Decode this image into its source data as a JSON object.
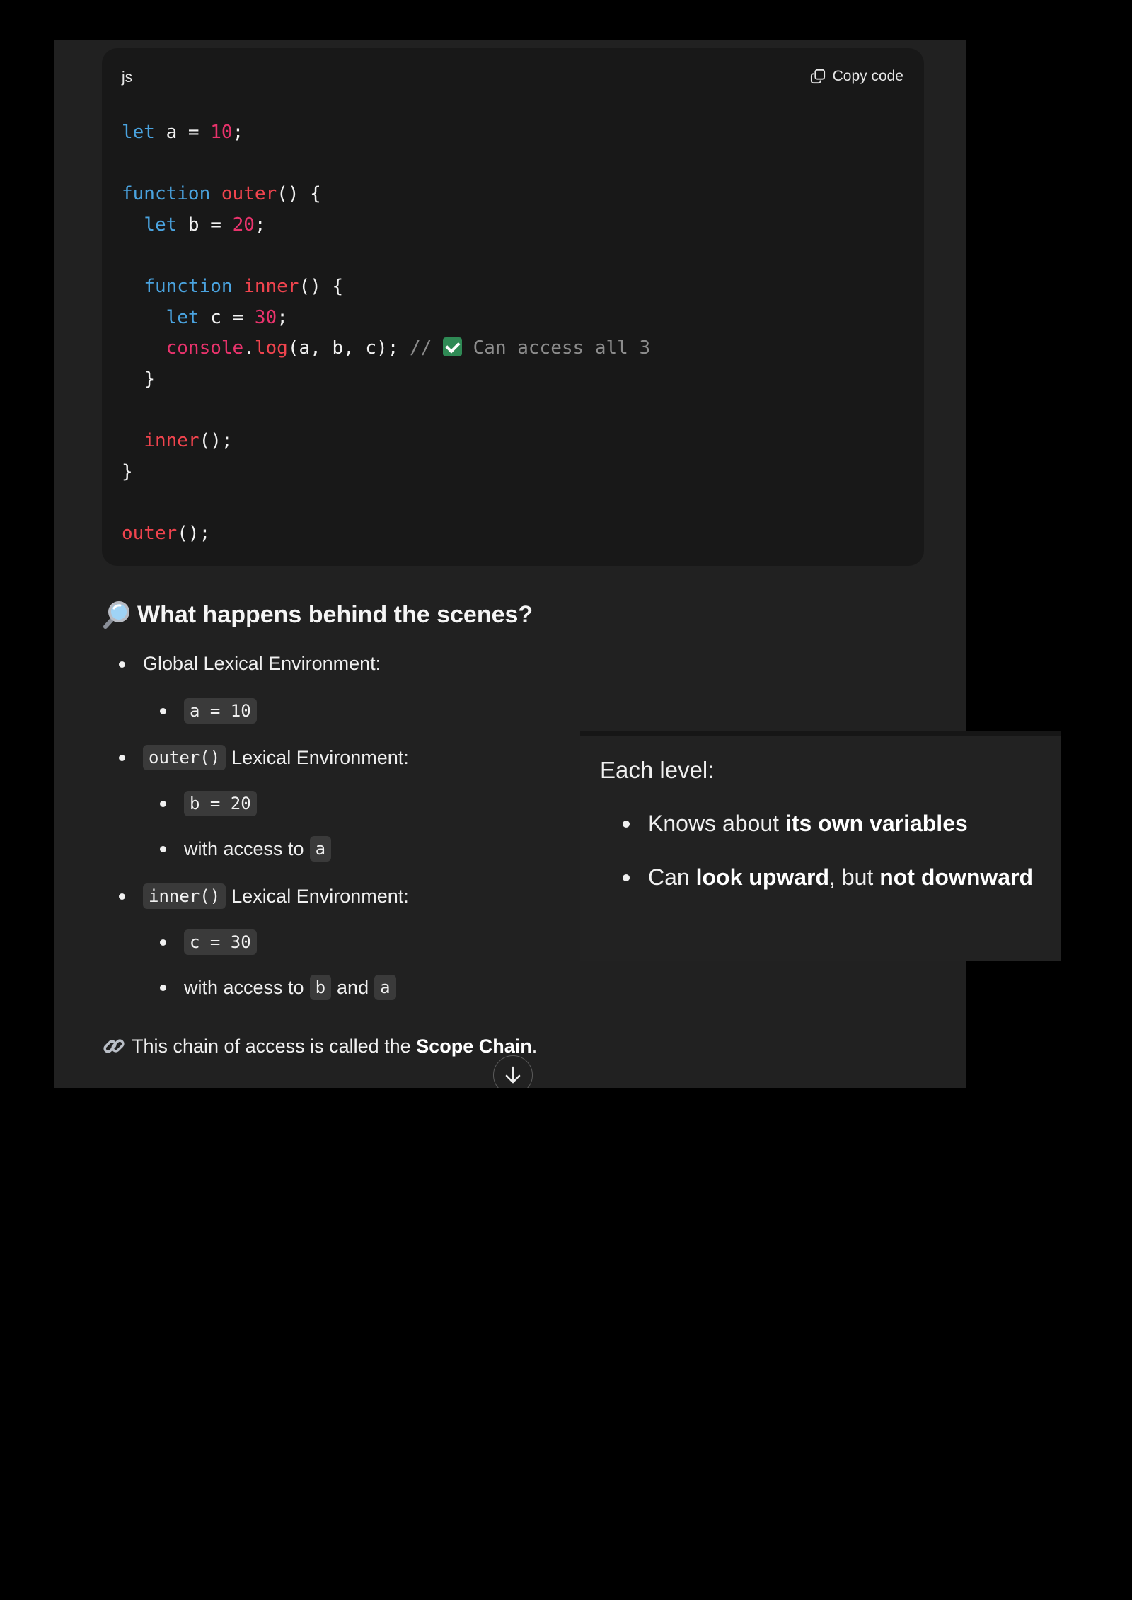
{
  "code_block": {
    "language": "js",
    "copy_label": "Copy code",
    "lines": [
      {
        "indent": "",
        "tokens": [
          {
            "t": "kw",
            "v": "let"
          },
          {
            "t": "pl",
            "v": " a = "
          },
          {
            "t": "num",
            "v": "10"
          },
          {
            "t": "pl",
            "v": ";"
          }
        ]
      },
      {
        "indent": "",
        "tokens": []
      },
      {
        "indent": "",
        "tokens": [
          {
            "t": "kw",
            "v": "function"
          },
          {
            "t": "pl",
            "v": " "
          },
          {
            "t": "fn",
            "v": "outer"
          },
          {
            "t": "pl",
            "v": "() {"
          }
        ]
      },
      {
        "indent": "  ",
        "tokens": [
          {
            "t": "kw",
            "v": "let"
          },
          {
            "t": "pl",
            "v": " b = "
          },
          {
            "t": "num",
            "v": "20"
          },
          {
            "t": "pl",
            "v": ";"
          }
        ]
      },
      {
        "indent": "",
        "tokens": []
      },
      {
        "indent": "  ",
        "tokens": [
          {
            "t": "kw",
            "v": "function"
          },
          {
            "t": "pl",
            "v": " "
          },
          {
            "t": "fn",
            "v": "inner"
          },
          {
            "t": "pl",
            "v": "() {"
          }
        ]
      },
      {
        "indent": "    ",
        "tokens": [
          {
            "t": "kw",
            "v": "let"
          },
          {
            "t": "pl",
            "v": " c = "
          },
          {
            "t": "num",
            "v": "30"
          },
          {
            "t": "pl",
            "v": ";"
          }
        ]
      },
      {
        "indent": "    ",
        "tokens": [
          {
            "t": "obj",
            "v": "console"
          },
          {
            "t": "pl",
            "v": "."
          },
          {
            "t": "fn",
            "v": "log"
          },
          {
            "t": "pl",
            "v": "(a, b, c); "
          },
          {
            "t": "cm",
            "v": "// "
          },
          {
            "t": "check",
            "v": "check-mark-icon"
          },
          {
            "t": "cm",
            "v": " Can access all 3"
          }
        ]
      },
      {
        "indent": "  ",
        "tokens": [
          {
            "t": "pl",
            "v": "}"
          }
        ]
      },
      {
        "indent": "",
        "tokens": []
      },
      {
        "indent": "  ",
        "tokens": [
          {
            "t": "fn",
            "v": "inner"
          },
          {
            "t": "pl",
            "v": "();"
          }
        ]
      },
      {
        "indent": "",
        "tokens": [
          {
            "t": "pl",
            "v": "}"
          }
        ]
      },
      {
        "indent": "",
        "tokens": []
      },
      {
        "indent": "",
        "tokens": [
          {
            "t": "fn",
            "v": "outer"
          },
          {
            "t": "pl",
            "v": "();"
          }
        ]
      }
    ]
  },
  "heading": {
    "icon": "magnifying-glass-icon",
    "text": "What happens behind the scenes?"
  },
  "list": {
    "global_label": "Global Lexical Environment:",
    "global_var": "a = 10",
    "outer_chip": "outer()",
    "outer_label": "Lexical Environment:",
    "outer_var": "b = 20",
    "outer_access_text": "with access to",
    "outer_access_a": "a",
    "inner_chip": "inner()",
    "inner_label": "Lexical Environment:",
    "inner_var": "c = 30",
    "inner_access_text": "with access to",
    "inner_access_b": "b",
    "inner_access_and": "and",
    "inner_access_a": "a"
  },
  "footer": {
    "icon": "link-icon",
    "text_before": "This chain of access is called the",
    "bold": "Scope Chain",
    "text_after": "."
  },
  "popup": {
    "title": "Each level:",
    "item1_before": "Knows about",
    "item1_bold": "its own variables",
    "item2_before": "Can",
    "item2_bold1": "look upward",
    "item2_mid": ", but",
    "item2_bold2": "not downward"
  },
  "scroll_button": {
    "icon": "arrow-down-icon"
  }
}
